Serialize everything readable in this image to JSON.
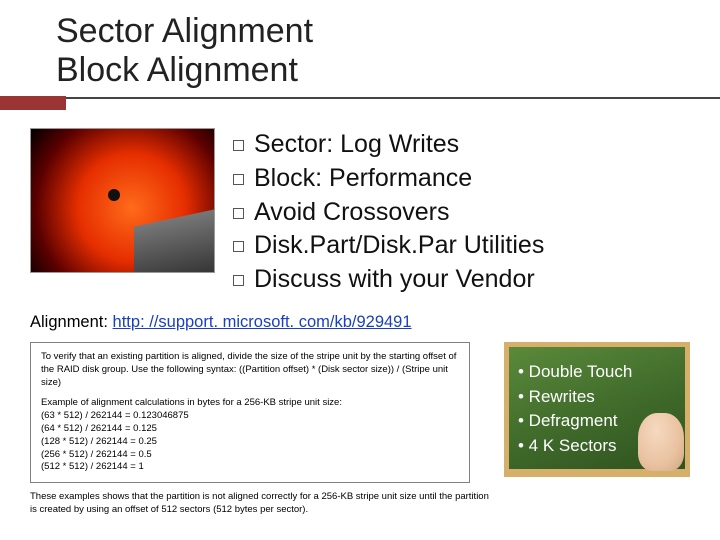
{
  "title_line1": "Sector Alignment",
  "title_line2": "Block Alignment",
  "bullets": {
    "b0": "Sector: Log Writes",
    "b1": "Block: Performance",
    "b2": "Avoid Crossovers",
    "b3": "Disk.Part/Disk.Par Utilities",
    "b4": "Discuss with your Vendor"
  },
  "align_label": "Alignment: ",
  "align_url_text": "http: //support. microsoft. com/kb/929491",
  "callout": {
    "p1": "To verify that an existing partition is aligned, divide the size of the stripe unit by the starting offset of the RAID disk group. Use the following syntax: ((Partition offset) * (Disk sector size)) / (Stripe unit size)",
    "p2_intro": "Example of alignment calculations in bytes for a 256-KB stripe unit size:",
    "c1": "(63 * 512) / 262144 = 0.123046875",
    "c2": "(64 * 512) / 262144 = 0.125",
    "c3": "(128 * 512) / 262144 = 0.25",
    "c4": "(256 * 512) / 262144 = 0.5",
    "c5": "(512 * 512) / 262144 = 1"
  },
  "footer": "These examples shows that the partition is not aligned correctly for a 256-KB stripe unit size until the partition is created by using an offset of 512 sectors (512 bytes per sector).",
  "chalk": {
    "i0": "• Double Touch",
    "i1": "• Rewrites",
    "i2": "• Defragment",
    "i3": "• 4 K Sectors"
  }
}
